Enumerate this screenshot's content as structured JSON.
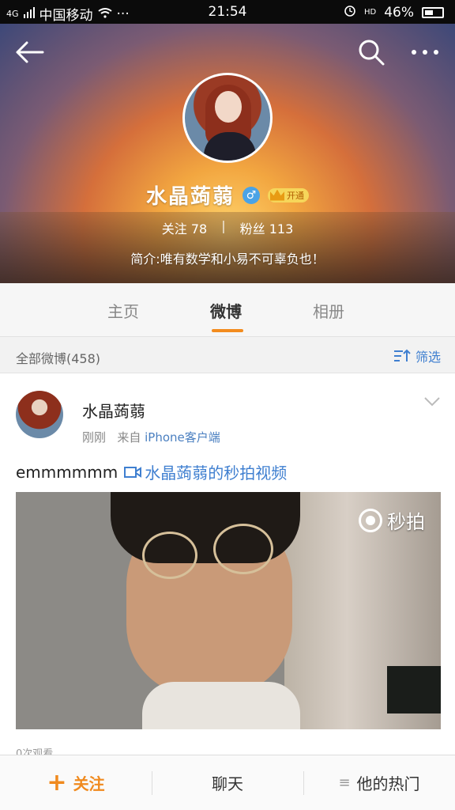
{
  "status_bar": {
    "network": "4G",
    "carrier": "中国移动",
    "dots": "···",
    "time": "21:54",
    "hd": "HD",
    "battery": "46%"
  },
  "profile": {
    "name": "水晶蒟蒻",
    "gender_symbol": "♂",
    "vip_label": "开通",
    "following_label": "关注",
    "following_count": "78",
    "separator": "|",
    "followers_label": "粉丝",
    "followers_count": "113",
    "bio": "简介:唯有数学和小易不可辜负也！"
  },
  "tabs": [
    {
      "label": "主页"
    },
    {
      "label": "微博"
    },
    {
      "label": "相册"
    }
  ],
  "filter": {
    "all_label": "全部微博(458)",
    "filter_label": "筛选"
  },
  "post": {
    "author": "水晶蒟蒻",
    "time": "刚刚",
    "source_prefix": "来自",
    "source": "iPhone客户端",
    "text": "emmmmmm",
    "video_link": "水晶蒟蒻的秒拍视频",
    "watermark": "秒拍",
    "views": "0次观看"
  },
  "bottom_bar": {
    "follow_plus": "+",
    "follow": "关注",
    "chat": "聊天",
    "menu_symbol": "≡",
    "hot": "他的热门"
  },
  "colors": {
    "accent": "#f38c1f",
    "link": "#3f7fd0"
  }
}
